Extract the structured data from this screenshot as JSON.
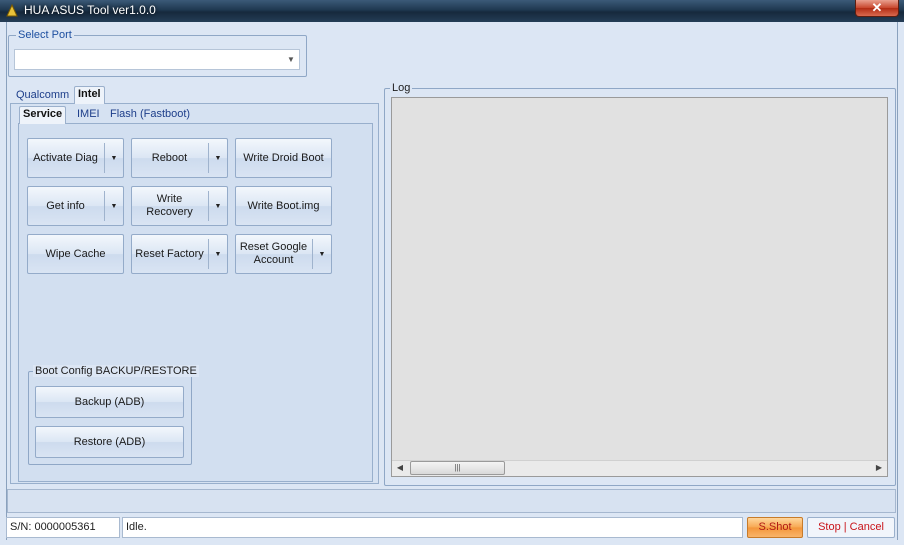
{
  "window": {
    "title": "HUA ASUS Tool ver1.0.0",
    "close_glyph": "✕"
  },
  "port": {
    "group_label": "Select Port",
    "value": ""
  },
  "main_tabs": [
    {
      "label": "Qualcomm"
    },
    {
      "label": "Intel"
    }
  ],
  "sub_tabs": [
    {
      "label": "Service"
    },
    {
      "label": "IMEI"
    },
    {
      "label": "Flash (Fastboot)"
    }
  ],
  "service_buttons": {
    "activate_diag": "Activate Diag",
    "reboot": "Reboot",
    "write_droid_boot": "Write Droid Boot",
    "get_info": "Get info",
    "write_recovery": "Write Recovery",
    "write_boot_img": "Write Boot.img",
    "wipe_cache": "Wipe Cache",
    "reset_factory": "Reset Factory",
    "reset_google_account": "Reset Google Account"
  },
  "boot_config": {
    "group_label": "Boot Config BACKUP/RESTORE",
    "backup": "Backup (ADB)",
    "restore": "Restore (ADB)"
  },
  "log": {
    "group_label": "Log",
    "content": ""
  },
  "status": {
    "serial": "S/N: 0000005361",
    "message": "Idle.",
    "sshot": "S.Shot",
    "stop_cancel": "Stop | Cancel"
  },
  "icons": {
    "dropdown": "chevron-down-icon",
    "scroll_left": "scroll-left-icon",
    "scroll_right": "scroll-right-icon",
    "grip": "grip-icon"
  }
}
